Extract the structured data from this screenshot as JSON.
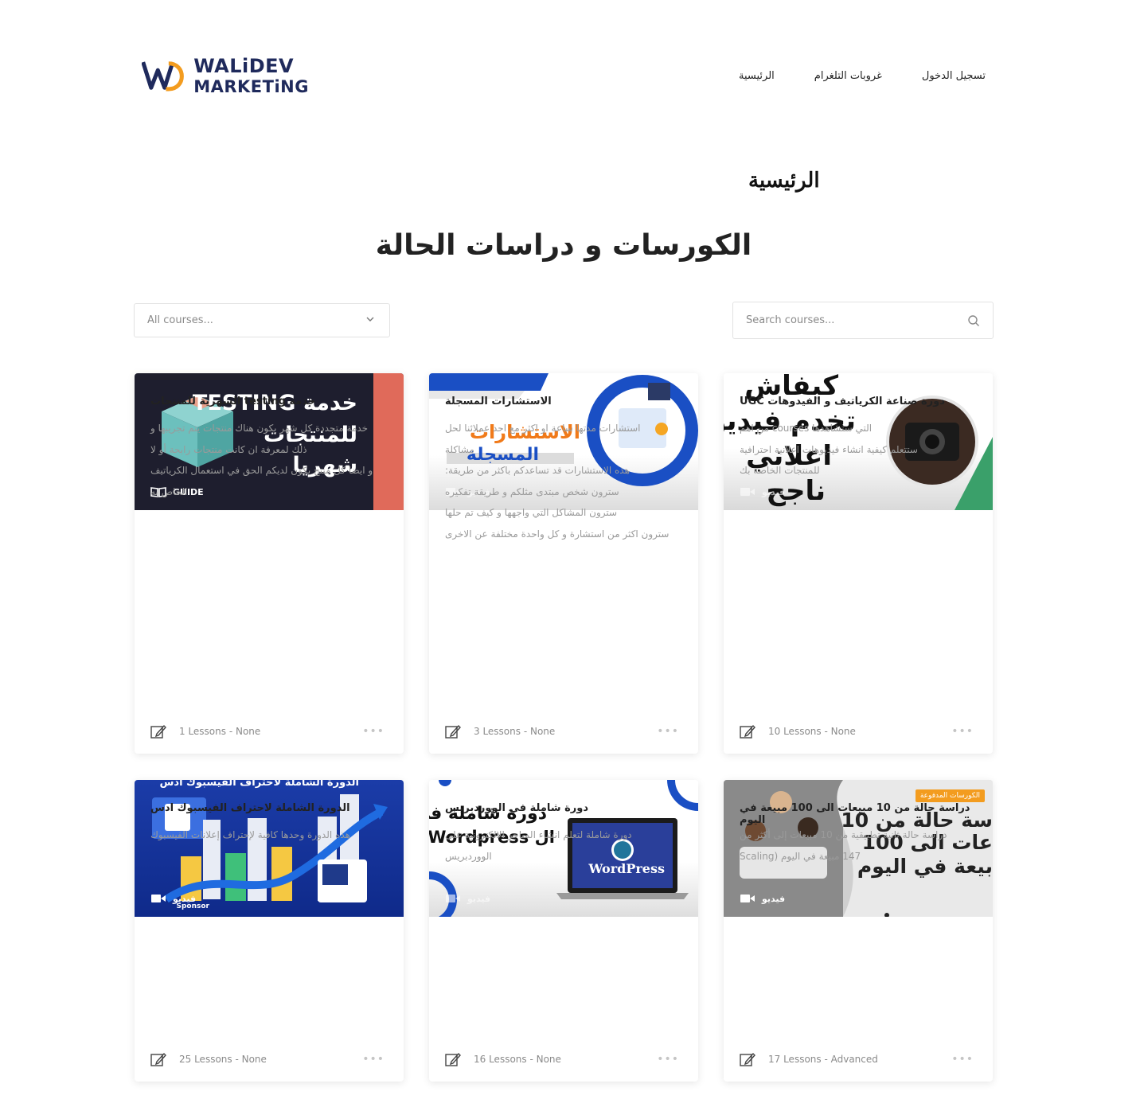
{
  "header": {
    "logo_line1": "WALiDEV",
    "logo_line2": "MARKETiNG",
    "nav": [
      {
        "label": "تسجيل الدخول"
      },
      {
        "label": "غروبات التلغرام"
      },
      {
        "label": "الرئيسية"
      }
    ]
  },
  "breadcrumb_title": "الرئيسية",
  "page_heading": "الكورسات و دراسات الحالة",
  "filters": {
    "category_select": "All courses...",
    "search_placeholder": "Search courses..."
  },
  "cards": [
    {
      "title": "خدمة testing الشهرية للمنتجات",
      "desc": [
        "خدمة متجددة كل شهر يكون هناك منتجات يتم تجريبها و",
        "ذلك لمعرفة ان كانت منتجات رابحة أو لا",
        "و ايضا كل منتج يكون لديكم الحق في استعمال الكرياتيف",
        "الخاص به"
      ],
      "meta": "1 Lessons - None",
      "tag": "GUIDE",
      "thumb_text": [
        "خدمة TESTING",
        "للمنتجات",
        "شهريا"
      ]
    },
    {
      "title": "الاستشارات المسجلة",
      "desc": [
        "استشارات مدتها ساعة او اكثر مع احد عملائنا لحل",
        "مشاكلة",
        "هذه الاستشارات قد تساعدكم باكثر من طريقة:",
        "سترون شخص مبتدى مثلكم و طريقة تفكيره",
        "سترون المشاكل التي واجهها و كيف تم حلها",
        "سترون اكثر من استشارة و كل واحدة مختلفة عن الاخرى"
      ],
      "meta": "3 Lessons - None",
      "tag": "فيديو",
      "thumb_text": [
        "الاستشارات",
        "المسجلة"
      ]
    },
    {
      "title": "دورة صناعة الكرياتيف و الفيدوهات UGC",
      "desc": [
        "التي ستشاهدها courses من اهم",
        "ستتعلم كيفية انشاء فيديوهات اعلانية احترافية",
        "للمنتجات الخاصة بك"
      ],
      "meta": "10 Lessons - None",
      "tag": "فيديو",
      "thumb_text": [
        "كيفاش",
        "تخدم فيديو",
        "اعلاني",
        "ناجح"
      ]
    },
    {
      "title": "الدورة الشاملة لاحتراف الفيسبوك ادس",
      "desc": [
        "هذه الدورة وحدها كافية لإحتراف إعلانات الفيسبوك"
      ],
      "meta": "25 Lessons - None",
      "tag": "فيديو",
      "thumb_text": [
        "الدورة الشاملة لاحتراف الفيسبوك ادس",
        "Sponsor"
      ]
    },
    {
      "title": "دورة شاملة في الووردبريس",
      "desc": [
        "دورة شاملة لتعلم انشاء المتاجر الالكترونية على",
        "الووردبريس"
      ],
      "meta": "16 Lessons - None",
      "tag": "فيديو",
      "thumb_text": [
        "دورة شاملة في",
        "ال Wordpress",
        "WordPress"
      ]
    },
    {
      "title": "دراسة حالة من 10 مبيعات الى 100 مبيعة في اليوم",
      "desc": [
        "دراسة حالة ثانية تطبيقية من 10 مبيعات إلى أكثر من",
        "147 مبيعة في اليوم (Scaling"
      ],
      "meta": "17 Lessons - Advanced",
      "tag": "فيديو",
      "badge": "الكورسات المدفوعة",
      "thumb_text": [
        "سة حالة من 10",
        "عات الى 100",
        "بيعة في اليوم"
      ]
    }
  ],
  "colors": {
    "navy": "#1f2a5c",
    "orange": "#f39c1f",
    "blue": "#1a4fc4",
    "card_shadow": "rgba(0,0,0,0.10)"
  }
}
